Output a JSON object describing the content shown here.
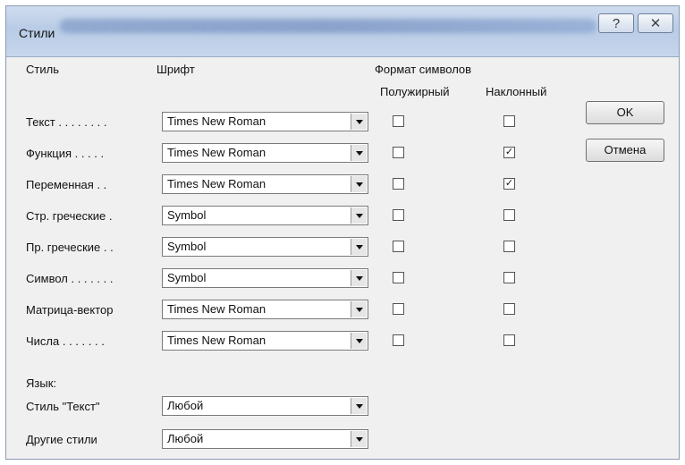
{
  "window": {
    "title": "Стили",
    "help_symbol": "?",
    "close_symbol": "✕"
  },
  "headers": {
    "style": "Стиль",
    "font": "Шрифт",
    "format": "Формат символов",
    "bold": "Полужирный",
    "italic": "Наклонный"
  },
  "rows": [
    {
      "label": "Текст . . . . . . . .",
      "font": "Times New Roman",
      "bold": "",
      "italic": ""
    },
    {
      "label": "Функция . . . . .",
      "font": "Times New Roman",
      "bold": "",
      "italic": "✓"
    },
    {
      "label": "Переменная . .",
      "font": "Times New Roman",
      "bold": "",
      "italic": "✓"
    },
    {
      "label": "Стр. греческие .",
      "font": "Symbol",
      "bold": "",
      "italic": ""
    },
    {
      "label": "Пр. греческие . .",
      "font": "Symbol",
      "bold": "",
      "italic": ""
    },
    {
      "label": "Символ . . . . . . .",
      "font": "Symbol",
      "bold": "",
      "italic": ""
    },
    {
      "label": "Матрица-вектор",
      "font": "Times New Roman",
      "bold": "",
      "italic": ""
    },
    {
      "label": "Числа . . . . . . .",
      "font": "Times New Roman",
      "bold": "",
      "italic": ""
    }
  ],
  "language": {
    "heading": "Язык:",
    "text_style_label": "Стиль \"Текст\"",
    "text_style_value": "Любой",
    "other_styles_label": "Другие стили",
    "other_styles_value": "Любой"
  },
  "buttons": {
    "ok": "OK",
    "cancel": "Отмена"
  }
}
